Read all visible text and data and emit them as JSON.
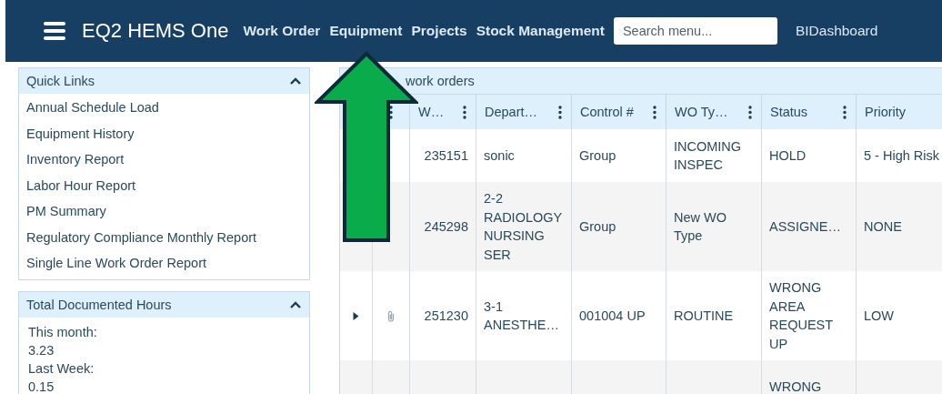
{
  "app": {
    "title": "EQ2 HEMS One"
  },
  "nav": [
    {
      "label": "Work Order"
    },
    {
      "label": "Equipment"
    },
    {
      "label": "Projects"
    },
    {
      "label": "Stock Management"
    }
  ],
  "search": {
    "placeholder": "Search menu..."
  },
  "nav_right": {
    "label": "BIDashboard"
  },
  "quick_links": {
    "title": "Quick Links",
    "expanded": true,
    "items": [
      "Annual Schedule Load",
      "Equipment History",
      "Inventory Report",
      "Labor Hour Report",
      "PM Summary",
      "Regulatory Compliance Monthly Report",
      "Single Line Work Order Report"
    ]
  },
  "hours_panel": {
    "title": "Total Documented Hours",
    "expanded": true,
    "lines": [
      "This month:",
      "3.23",
      "Last Week:",
      "0.15"
    ]
  },
  "table": {
    "title": "work orders",
    "columns": [
      "W…",
      "Depart…",
      "Control #",
      "WO Ty…",
      "Status",
      "Priority"
    ],
    "rows": [
      {
        "cells": [
          "235151",
          "sonic",
          "Group",
          "INCOMING INSPEC",
          "HOLD",
          "5 - High Risk"
        ]
      },
      {
        "cells": [
          "245298",
          "2-2 RADIOLOGY NURSING SER",
          "Group",
          "New WO Type",
          "ASSIGNE…",
          "NONE"
        ]
      },
      {
        "expanded": false,
        "attachment": true,
        "cells": [
          "251230",
          "3-1 ANESTHE…",
          "001004 UP",
          "ROUTINE",
          "WRONG AREA REQUEST UP",
          "LOW"
        ]
      },
      {
        "attachment": false,
        "cells": [
          null,
          null,
          null,
          null,
          "WRONG",
          null
        ]
      }
    ]
  }
}
